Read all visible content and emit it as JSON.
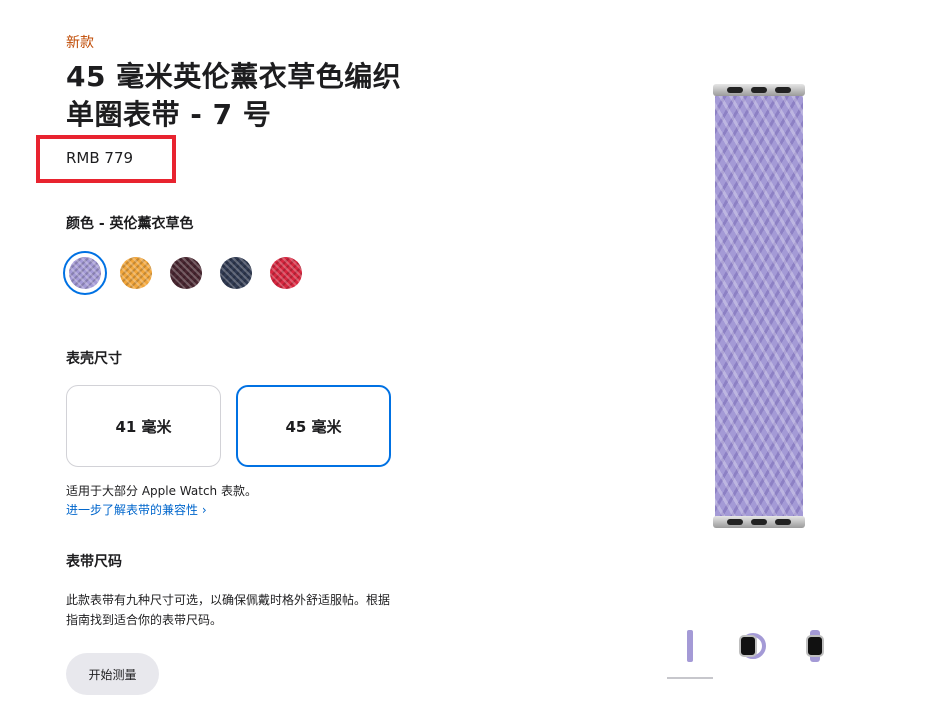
{
  "product": {
    "badge": "新款",
    "title": "45 毫米英伦薰衣草色编织单圈表带 - 7 号",
    "price": "RMB 779"
  },
  "color": {
    "label": "颜色 - 英伦薰衣草色",
    "swatches": [
      {
        "name": "英伦薰衣草色",
        "color": "#a49ad6",
        "selected": true
      },
      {
        "name": "orange",
        "color": "#f2a63b",
        "selected": false
      },
      {
        "name": "dark-cherry",
        "color": "#4a2731",
        "selected": false
      },
      {
        "name": "navy",
        "color": "#303a52",
        "selected": false
      },
      {
        "name": "red",
        "color": "#d8263f",
        "selected": false
      }
    ]
  },
  "case_size": {
    "label": "表壳尺寸",
    "options": [
      {
        "label": "41 毫米",
        "selected": false
      },
      {
        "label": "45 毫米",
        "selected": true
      }
    ],
    "compat_text": "适用于大部分 Apple Watch 表款。",
    "compat_link": "进一步了解表带的兼容性 ›"
  },
  "band_size": {
    "label": "表带尺码",
    "description": "此款表带有九种尺寸可选，以确保佩戴时格外舒适服帖。根据指南找到适合你的表带尺码。",
    "button": "开始测量"
  },
  "colors": {
    "accent": "#0071e3",
    "link": "#0066cc",
    "badge": "#bf4800",
    "highlight_box": "#e8232f"
  },
  "thumbnails": [
    {
      "name": "band-side-view",
      "selected": true
    },
    {
      "name": "band-loop-view",
      "selected": false
    },
    {
      "name": "band-on-watch-view",
      "selected": false
    }
  ]
}
